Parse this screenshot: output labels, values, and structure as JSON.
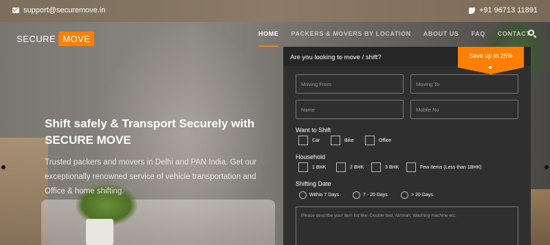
{
  "topbar": {
    "email": "support@securemove.in",
    "phone": "+91 96713 11891"
  },
  "logo": {
    "part1": "SECURE",
    "part2": "MOVE"
  },
  "nav": {
    "items": [
      {
        "label": "HOME"
      },
      {
        "label": "PACKERS & MOVERS BY LOCATION"
      },
      {
        "label": "ABOUT US"
      },
      {
        "label": "FAQ"
      },
      {
        "label": "CONTACT"
      }
    ]
  },
  "hero": {
    "title": "Shift safely & Transport Securely with SECURE MOVE",
    "description": "Trusted packers and movers in Delhi and PAN India. Get our exceptionally renowned service of vehicle transportation and Office & home shifting."
  },
  "form": {
    "heading": "Are you looking to move / shift?",
    "badge": "Save up to 25%",
    "moving_from_placeholder": "Moving From",
    "moving_to_placeholder": "Moving To",
    "name_placeholder": "Name",
    "mobile_placeholder": "Mobile No",
    "want_to_shift_label": "Want to Shift",
    "shift_options": [
      "Car",
      "Bike",
      "Office"
    ],
    "household_label": "Household",
    "household_options": [
      "1 BHK",
      "2 BHK",
      "3 BHK",
      "Few Items (Less than 1BHK)"
    ],
    "shifting_date_label": "Shifting Date",
    "date_options": [
      "Within 7 Days",
      "7 - 20 Days",
      "> 20 Days"
    ],
    "items_placeholder": "Please describe your item list like:-Double bed, Almirah, Washing machine etc."
  },
  "colors": {
    "accent": "#ff7f00",
    "panel": "#2f2f2f"
  }
}
